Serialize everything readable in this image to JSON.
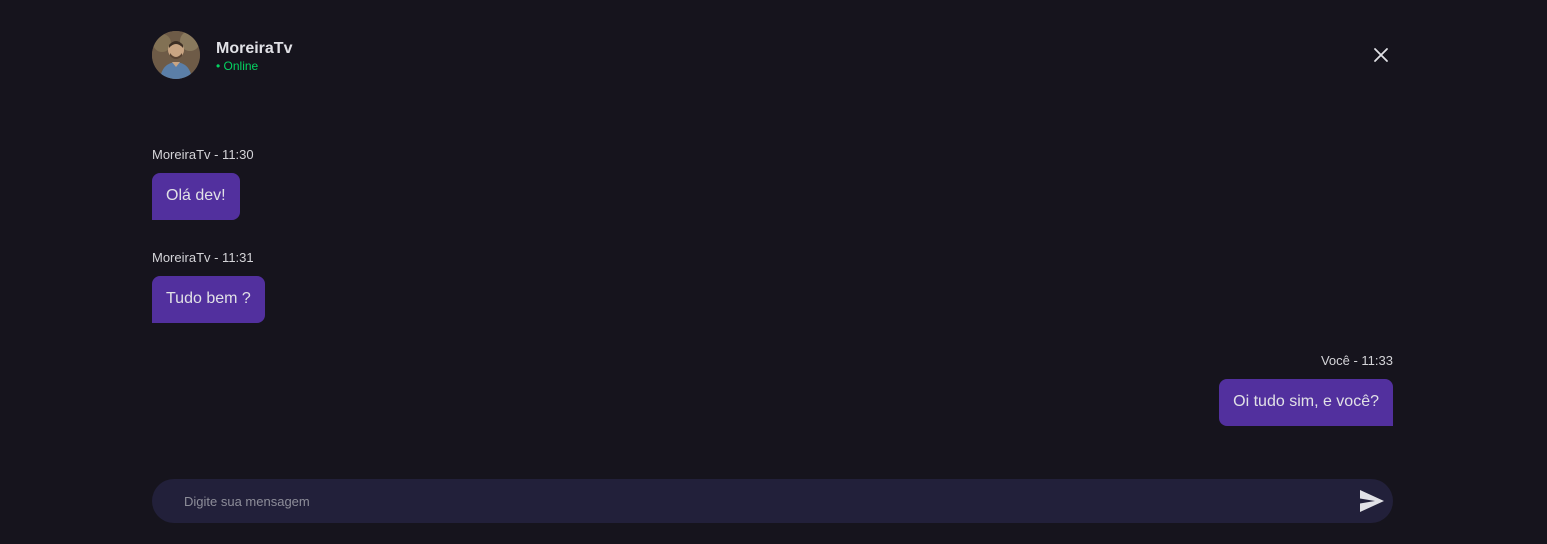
{
  "header": {
    "user_name": "MoreiraTv",
    "status": "• Online",
    "close_icon": "close-icon",
    "avatar_icon": "avatar"
  },
  "messages": [
    {
      "author_time": "MoreiraTv - 11:30",
      "text": "Olá dev!",
      "direction": "received"
    },
    {
      "author_time": "MoreiraTv - 11:31",
      "text": "Tudo bem ?",
      "direction": "received"
    },
    {
      "author_time": "Você - 11:33",
      "text": "Oi tudo sim, e você?",
      "direction": "sent"
    }
  ],
  "composer": {
    "placeholder": "Digite sua mensagem",
    "value": "",
    "send_icon": "send-icon"
  },
  "colors": {
    "background": "#16141d",
    "bubble": "#52309e",
    "status_online": "#04d361",
    "composer": "#22203a"
  }
}
